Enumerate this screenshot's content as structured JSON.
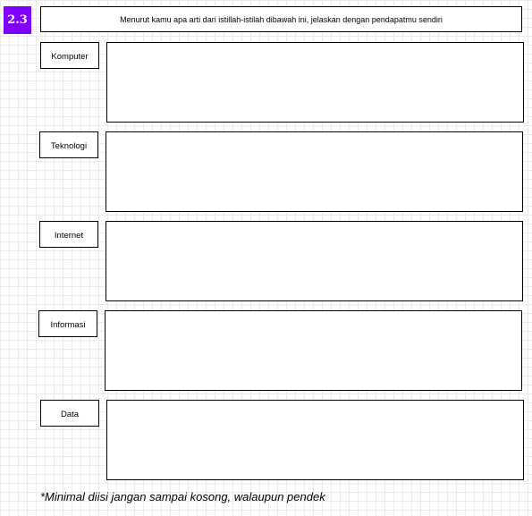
{
  "question_number": "2.3",
  "instruction": "Menurut kamu apa arti dari istillah-istilah dibawah ini, jelaskan dengan pendapatmu sendiri",
  "terms": [
    {
      "label": "Komputer",
      "answer": ""
    },
    {
      "label": "Teknologi",
      "answer": ""
    },
    {
      "label": "Internet",
      "answer": ""
    },
    {
      "label": "Informasi",
      "answer": ""
    },
    {
      "label": "Data",
      "answer": ""
    }
  ],
  "footer_note": "*Minimal diisi jangan sampai kosong, walaupun pendek",
  "colors": {
    "badge": "#7f00ff",
    "border": "#000000",
    "grid": "#ececec"
  }
}
